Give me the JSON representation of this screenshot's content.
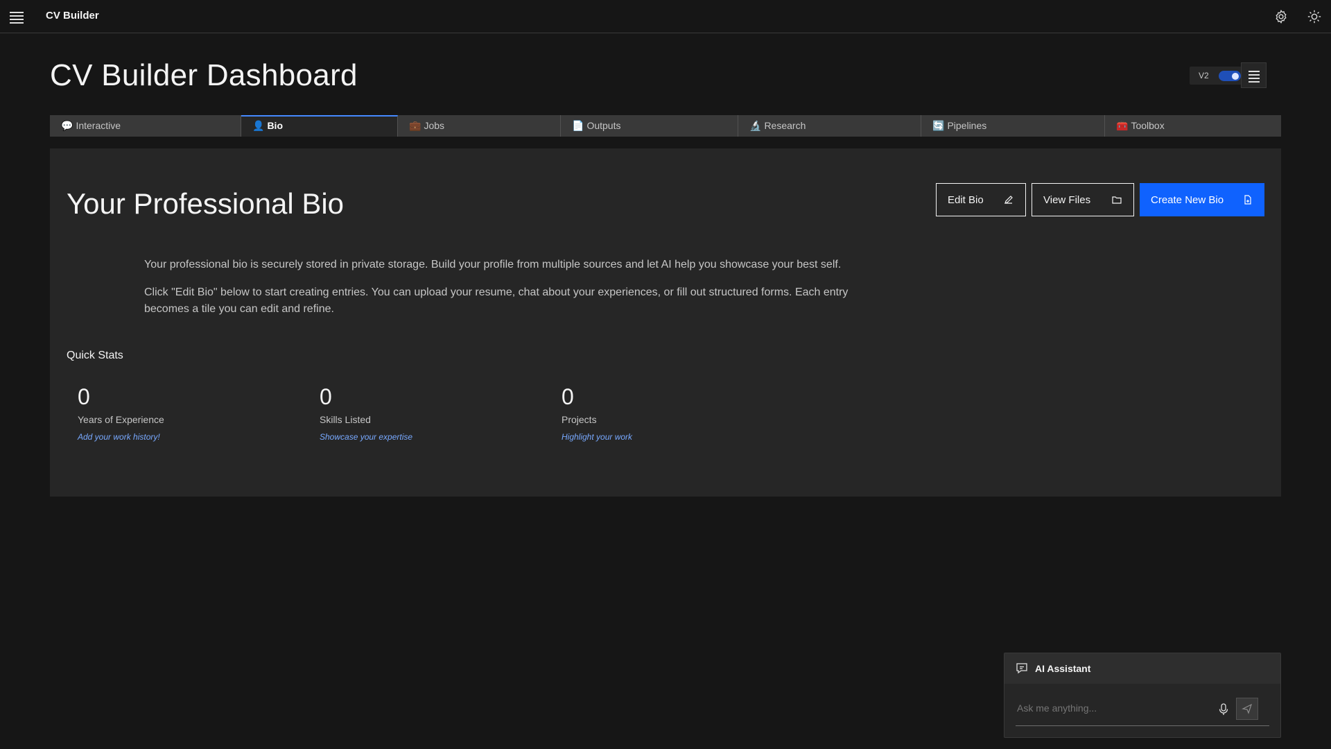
{
  "app": {
    "title": "CV Builder"
  },
  "header": {
    "page_title": "CV Builder Dashboard",
    "version_label": "V2"
  },
  "tabs": [
    {
      "icon": "💬",
      "label": "Interactive"
    },
    {
      "icon": "👤",
      "label": "Bio"
    },
    {
      "icon": "💼",
      "label": "Jobs"
    },
    {
      "icon": "📄",
      "label": "Outputs"
    },
    {
      "icon": "🔬",
      "label": "Research"
    },
    {
      "icon": "🔄",
      "label": "Pipelines"
    },
    {
      "icon": "🧰",
      "label": "Toolbox"
    }
  ],
  "bio": {
    "title": "Your Professional Bio",
    "buttons": {
      "edit": "Edit Bio",
      "view": "View Files",
      "create": "Create New Bio"
    },
    "intro": [
      "Your professional bio is securely stored in private storage. Build your profile from multiple sources and let AI help you showcase your best self.",
      "Click \"Edit Bio\" below to start creating entries. You can upload your resume, chat about your experiences, or fill out structured forms. Each entry becomes a tile you can edit and refine."
    ],
    "quick_stats_label": "Quick Stats",
    "stats": [
      {
        "value": "0",
        "label": "Years of Experience",
        "link": "Add your work history!"
      },
      {
        "value": "0",
        "label": "Skills Listed",
        "link": "Showcase your expertise"
      },
      {
        "value": "0",
        "label": "Projects",
        "link": "Highlight your work"
      }
    ]
  },
  "assistant": {
    "title": "AI Assistant",
    "placeholder": "Ask me anything..."
  },
  "colors": {
    "primary": "#0f62fe",
    "background": "#161616",
    "panel": "#262626",
    "link": "#78a9ff"
  }
}
